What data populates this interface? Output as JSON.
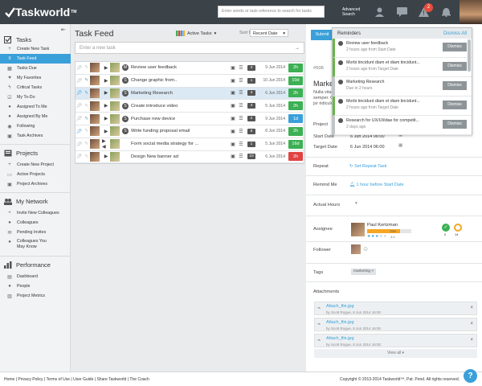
{
  "header": {
    "logo_text": "Taskworld",
    "logo_tm": "TM",
    "search_placeholder": "Enter words or task reference to search for tasks",
    "advanced_search": "Advanced Search",
    "notification_count": "2"
  },
  "sidebar": {
    "tasks": {
      "title": "Tasks",
      "items": [
        {
          "label": "Create New Task",
          "icon": "plus-icon"
        },
        {
          "label": "Task Feed",
          "icon": "feed-icon",
          "active": true
        },
        {
          "label": "Tasks Due",
          "icon": "calendar-icon"
        },
        {
          "label": "My Favorites",
          "icon": "heart-icon"
        },
        {
          "label": "Critical Tasks",
          "icon": "bolt-icon"
        },
        {
          "label": "My To-Do",
          "icon": "checkbox-icon"
        },
        {
          "label": "Assigned To Me",
          "icon": "user-icon"
        },
        {
          "label": "Assigned By Me",
          "icon": "user-icon"
        },
        {
          "label": "Following",
          "icon": "eye-icon"
        },
        {
          "label": "Task Archives",
          "icon": "archive-icon"
        }
      ]
    },
    "projects": {
      "title": "Projects",
      "items": [
        {
          "label": "Create New Project"
        },
        {
          "label": "Active Projects"
        },
        {
          "label": "Project Archives"
        }
      ]
    },
    "network": {
      "title": "My Network",
      "items": [
        {
          "label": "Invite New Colleagues"
        },
        {
          "label": "Colleagues"
        },
        {
          "label": "Pending Invites"
        },
        {
          "label": "Colleagues You May Know"
        }
      ]
    },
    "performance": {
      "title": "Performance",
      "items": [
        {
          "label": "Dashboard"
        },
        {
          "label": "People"
        },
        {
          "label": "Project Metrics"
        }
      ]
    }
  },
  "feed": {
    "title": "Task Feed",
    "view": "Active Tasks",
    "sort_by": "Sort By",
    "sort_value": "Recent Date",
    "new_task_placeholder": "Enter a new task",
    "tasks": [
      {
        "name": "Review user feedback",
        "status": "M",
        "count": "3",
        "date": "9 Jun 2014",
        "duration": "2h",
        "dcolor": "#3cb054",
        "pinned": false,
        "critical": false,
        "arrow": "▶",
        "selected": false
      },
      {
        "name": "Change graphic from..",
        "status": "S",
        "count": "1",
        "date": "10 Jun 2014",
        "duration": "10d",
        "dcolor": "#3cb054",
        "pinned": false,
        "critical": true,
        "arrow": "▶",
        "selected": false
      },
      {
        "name": "Marketing Research",
        "status": "S",
        "count": "3",
        "date": "6 Jun 2014",
        "duration": "2h",
        "dcolor": "#3cb054",
        "pinned": true,
        "critical": true,
        "arrow": "▶",
        "selected": true
      },
      {
        "name": "Create introduce video",
        "status": "S",
        "count": "4",
        "date": "5 Jun 2014",
        "duration": "2h",
        "dcolor": "#3cb054",
        "pinned": false,
        "critical": false,
        "arrow": "▶",
        "selected": false
      },
      {
        "name": "Purchase new device",
        "status": "S",
        "count": "2",
        "date": "9 Jun 2014",
        "duration": "1d",
        "dcolor": "#3aa0d9",
        "pinned": false,
        "critical": true,
        "arrow": "▶",
        "selected": false
      },
      {
        "name": "Write funding proposal email",
        "status": "S",
        "count": "6",
        "date": "8 Jun 2014",
        "duration": "2h",
        "dcolor": "#3cb054",
        "pinned": true,
        "critical": false,
        "arrow": "▶",
        "selected": false
      },
      {
        "name": "Form social media strategy for ...",
        "status": "",
        "count": "1",
        "date": "5 Jun 2014",
        "duration": "16d",
        "dcolor": "#3cb054",
        "pinned": false,
        "critical": false,
        "arrow": "▶ ◀",
        "selected": false
      },
      {
        "name": "Design New banner ad",
        "status": "",
        "count": "10",
        "date": "6 Jun 2014",
        "duration": "2h",
        "dcolor": "#e04343",
        "pinned": false,
        "critical": false,
        "arrow": "▶",
        "selected": false
      }
    ]
  },
  "detail": {
    "submit_label": "Submit",
    "ref": "#506",
    "task_title": "Marketing Research",
    "desc_line1": "Nulla vitae",
    "desc_line2": "semper. Ci",
    "desc_line3": "jsr ridiculu",
    "project_label": "Project",
    "start_label": "Start Date",
    "start_value": "6 Jun 2014   06:00",
    "target_label": "Target Date",
    "target_value": "6 Jun 2014   06:00",
    "repeat_label": "Repeat",
    "repeat_value": "Set Repeat Task",
    "remind_label": "Remind Me",
    "remind_value": "1 hour before Start Date",
    "hours_label": "Actual Hours",
    "assignee_label": "Assignee",
    "assignee_name": "Paul Kertzman",
    "assignee_progress": 0.75,
    "assignee_progress_text": "75%",
    "assignee_rating": "4.6",
    "assignee_rating_stars": 3,
    "approvals_count": "0",
    "pending_count": "14",
    "follower_label": "Follower",
    "tags_label": "Tags",
    "tag": "marketing",
    "attachments_label": "Attachments",
    "attachments": [
      {
        "name": "Attach_file.jpg",
        "by": "by Scott Rogue, 8 Jun 2014 16:00"
      },
      {
        "name": "Attach_file.jpg",
        "by": "by Scott Rogue, 8 Jun 2014 16:00"
      },
      {
        "name": "Attach_file.jpg",
        "by": "by Scott Rogue, 8 Jun 2014 16:00"
      }
    ],
    "view_all": "View all ▾"
  },
  "reminders": {
    "title": "Reminders",
    "dismiss_all": "Dismiss All",
    "dismiss_label": "Dismiss",
    "items": [
      {
        "title": "Review user feedback",
        "sub": "2 hours ago from Start Date",
        "read": false
      },
      {
        "title": "Morbi tincidunt diam et diam tincidunt...",
        "sub": "2 hours ago from Target Date",
        "read": false
      },
      {
        "title": "Marketing Research",
        "sub": "Due in 2 hours",
        "read": true
      },
      {
        "title": "Morbi tincidunt diam et diam tincidunt...",
        "sub": "2 hours ago from Target Date",
        "read": false
      },
      {
        "title": "Research for UX/UI/idae for competit...",
        "sub": "2 days ago",
        "read": true
      }
    ]
  },
  "footer": {
    "links": [
      "Home",
      "Privacy Policy",
      "Terms of Use",
      "User Guide",
      "Share Taskworld",
      "The Coach"
    ],
    "copyright": "Copyright © 2013-2014 Taskworld™, Pat. Pend. All rights reserved."
  },
  "colors": {
    "accent": "#3aa0d9",
    "header": "#3b4349",
    "green": "#3cb054",
    "red": "#e04343"
  }
}
